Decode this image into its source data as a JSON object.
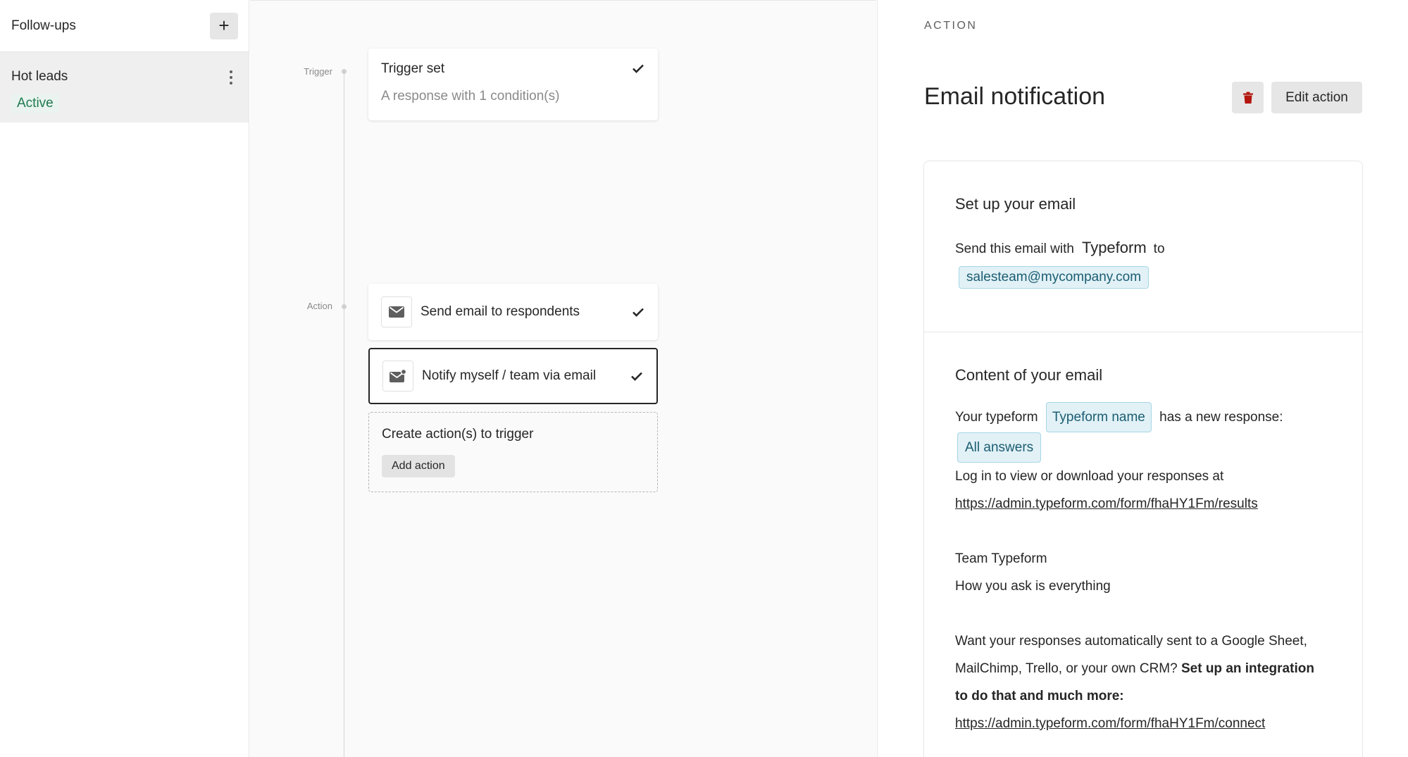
{
  "sidebar": {
    "title": "Follow-ups",
    "add_icon": "plus-icon",
    "items": [
      {
        "name": "Hot leads",
        "status": "Active",
        "status_color": "#1f7a4f"
      }
    ]
  },
  "canvas": {
    "rail_labels": {
      "trigger": "Trigger",
      "action": "Action"
    },
    "trigger_card": {
      "title": "Trigger set",
      "subtitle": "A response with 1 condition(s)"
    },
    "actions": [
      {
        "label": "Send email to respondents",
        "icon": "mail-icon",
        "selected": false
      },
      {
        "label": "Notify myself / team via email",
        "icon": "mail-notify-icon",
        "selected": true
      }
    ],
    "create_card": {
      "title": "Create action(s) to trigger",
      "button": "Add action"
    }
  },
  "panel": {
    "eyebrow": "ACTION",
    "title": "Email notification",
    "edit_button": "Edit action",
    "trash_color": "#b3160f",
    "setup": {
      "title": "Set up your email",
      "send_prefix": "Send this email with",
      "provider": "Typeform",
      "send_suffix": "to",
      "recipient": "salesteam@mycompany.com"
    },
    "content": {
      "title": "Content of your email",
      "line1_prefix": "Your typeform",
      "line1_pill": "Typeform name",
      "line1_suffix": "has a new response:",
      "answers_pill": "All answers",
      "login_text": "Log in to view or download your responses at",
      "results_link": "https://admin.typeform.com/form/fhaHY1Fm/results",
      "signoff1": "Team Typeform",
      "signoff2": "How you ask is everything",
      "integration_text1": "Want your responses automatically sent to a Google Sheet,",
      "integration_text2": "MailChimp, Trello, or your own CRM?",
      "integration_bold1": "Set up an integration",
      "integration_bold2": "to do that and much more:",
      "connect_link": "https://admin.typeform.com/form/fhaHY1Fm/connect"
    }
  }
}
